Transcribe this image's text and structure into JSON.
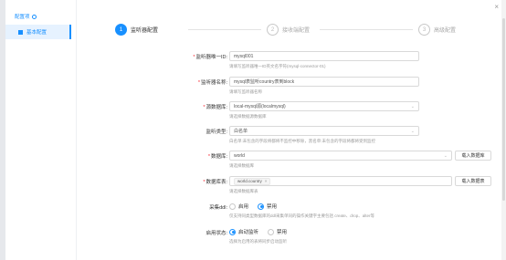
{
  "sidebar": {
    "title": "配置项",
    "items": [
      {
        "label": "基本配置"
      }
    ]
  },
  "steps": [
    {
      "num": "1",
      "label": "监听器配置",
      "active": true
    },
    {
      "num": "2",
      "label": "接收端配置",
      "active": false
    },
    {
      "num": "3",
      "label": "高级配置",
      "active": false
    }
  ],
  "form": {
    "listener_id": {
      "label": "监听器唯一ID:",
      "value": "mysql001",
      "hint": "请填写监听器唯一ID英文名字符(mysql-connector-01)"
    },
    "listener_name": {
      "label": "监听器名称:",
      "value": "mysql表监听country表到block",
      "hint": "请填写监听器名称"
    },
    "source_db": {
      "label": "源数据库:",
      "value": "local-mysql源(localmysql)",
      "hint": "请选择数据源数据库"
    },
    "listen_type": {
      "label": "监听类型:",
      "value": "白名单",
      "hint": "白名单:未包含的字段将都将不监控中移除，黑名单:未包含的字段将都将受到监控"
    },
    "database": {
      "label": "数据库:",
      "value": "world",
      "button": "载入数据库",
      "hint": "请选择数据库"
    },
    "tables": {
      "label": "数据库表:",
      "tags": [
        "world.country"
      ],
      "button": "载入数据表",
      "hint": "请选择数据库表"
    },
    "collect_ddl": {
      "label": "采集ddl:",
      "options": [
        "启用",
        "禁用"
      ],
      "selected": 1,
      "hint": "仅支持同类型数据库的ddl采集单同的操作关键字主要包括 create、drop、alter等"
    },
    "enable_status": {
      "label": "启用状态:",
      "options": [
        "启动监听",
        "禁用"
      ],
      "selected": 0,
      "hint": "选择为启用的表将同步启动监听"
    }
  },
  "window": {
    "close": "×"
  }
}
